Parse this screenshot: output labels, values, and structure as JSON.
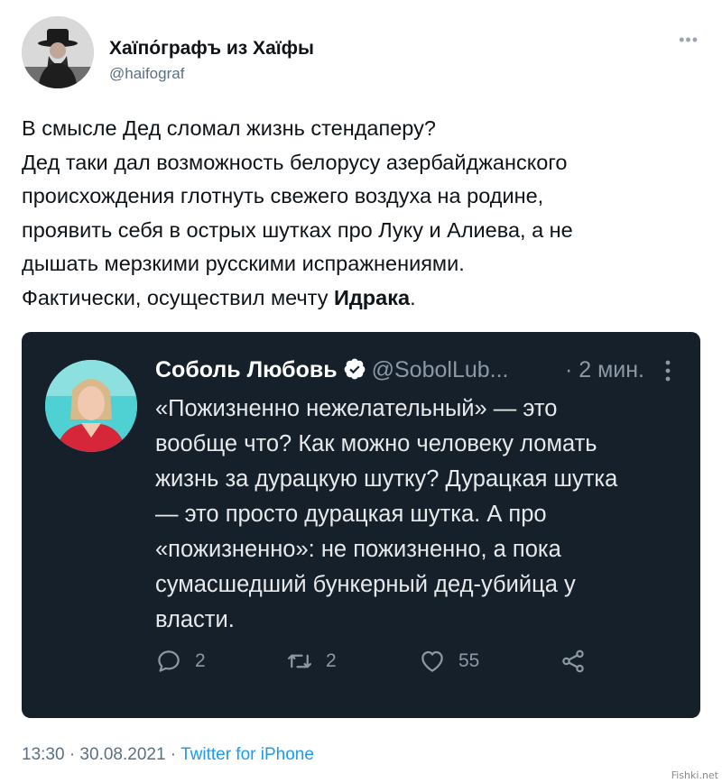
{
  "author": {
    "name": "Хаїпо́графъ из Хаїфы",
    "handle": "@haifograf",
    "avatar_icon": "profile-photo"
  },
  "tweet": {
    "lines": [
      "В смысле Дед сломал жизнь стендаперу?",
      "Дед таки дал возможность белорусу азербайджанского",
      "происхождения глотнуть свежего воздуха на родине,",
      "проявить себя в острых шутках про Луку и Алиева, а не",
      "дышать мерзкими русскими испражнениями."
    ],
    "last_line_prefix": "Фактически, осуществил мечту ",
    "last_line_bold": "Идрака",
    "last_line_suffix": "."
  },
  "quoted": {
    "name": "Соболь Любовь",
    "handle": "@SobolLub...",
    "time": "· 2 мин.",
    "lines": [
      "«Пожизненно нежелательный» — это",
      "вообще что? Как можно человеку ломать",
      "жизнь за дурацкую шутку? Дурацкая шутка",
      "— это просто дурацкая шутка. А про",
      "«пожизненно»: не пожизненно, а пока",
      "сумасшедший бункерный дед-убийца у",
      "власти."
    ],
    "replies": "2",
    "retweets": "2",
    "likes": "55",
    "colors": {
      "background": "#15202b",
      "text": "#e7e9ea",
      "muted": "#8b98a5",
      "verified": "#ffffff"
    }
  },
  "footer": {
    "time": "13:30 · 30.08.2021 · ",
    "source": "Twitter for iPhone"
  },
  "watermark": "Fishki.net"
}
